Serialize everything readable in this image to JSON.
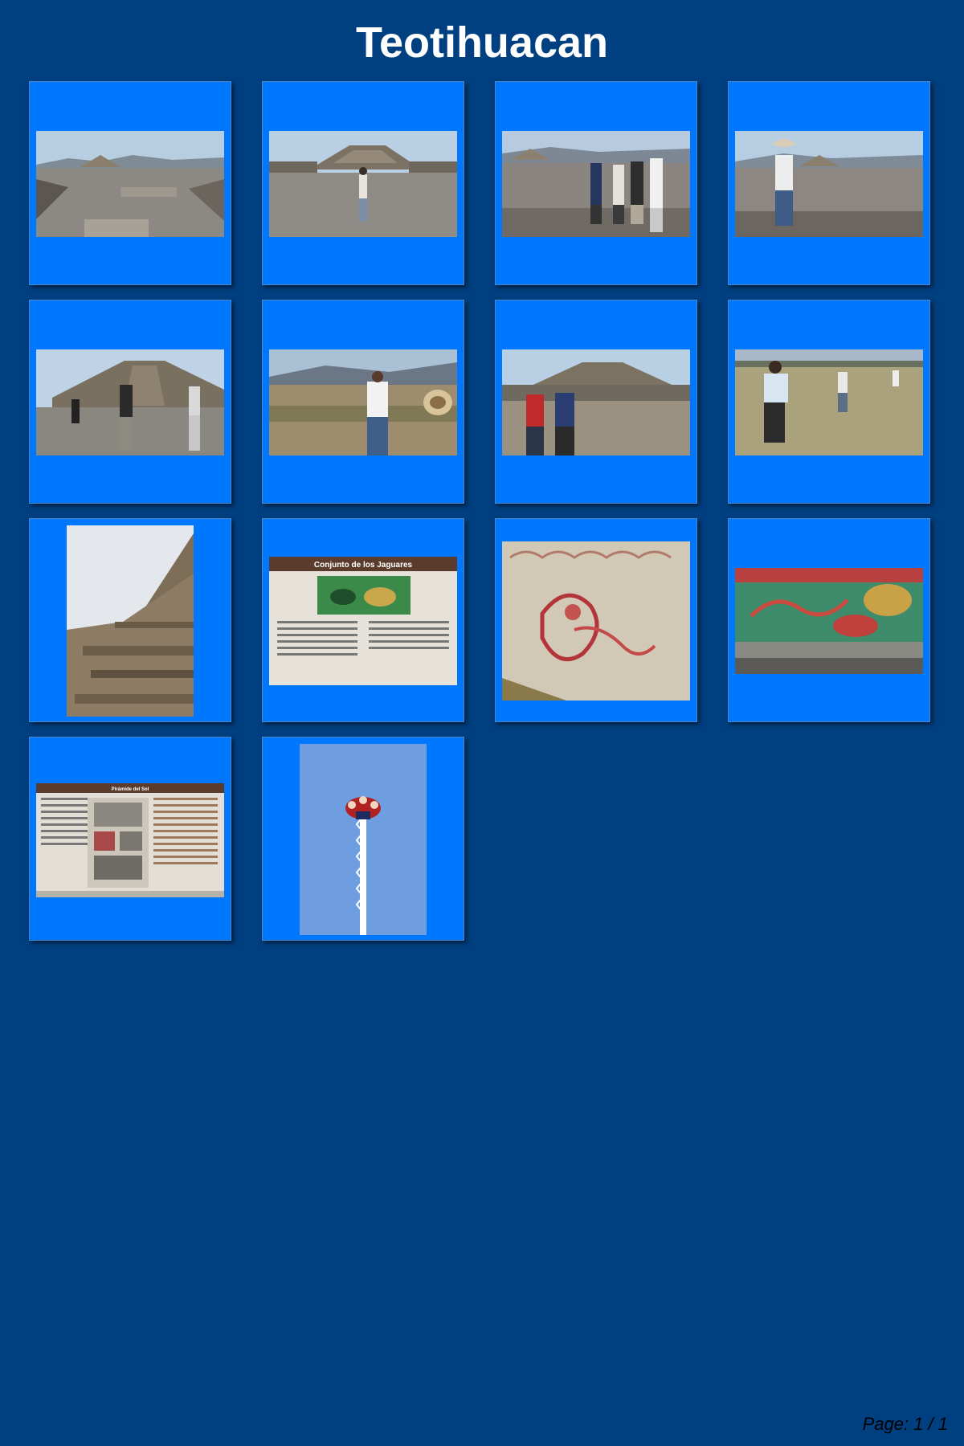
{
  "page": {
    "title": "Teotihuacan",
    "page_indicator": "Page: 1 / 1"
  },
  "colors": {
    "background": "#003f80",
    "card": "#0077ff",
    "title_text": "#ffffff",
    "page_text": "#000000"
  },
  "photos": [
    {
      "scene": "avenue-view-from-pyramid"
    },
    {
      "scene": "person-in-front-of-pyramid"
    },
    {
      "scene": "group-of-four-on-pyramid"
    },
    {
      "scene": "woman-with-hat-overlooking-avenue"
    },
    {
      "scene": "three-people-before-pyramid-of-the-sun"
    },
    {
      "scene": "woman-on-summit-overlooking-valley"
    },
    {
      "scene": "two-men-walking-before-pyramid"
    },
    {
      "scene": "people-walking-in-field"
    },
    {
      "scene": "carved-temple-wall"
    },
    {
      "scene": "jaguar-complex-information-sign",
      "sign_title": "Conjunto de los Jaguares"
    },
    {
      "scene": "red-mural-fresco"
    },
    {
      "scene": "green-jaguar-fresco"
    },
    {
      "scene": "pyramid-information-panel",
      "sign_title": "Pirámide del Sol"
    },
    {
      "scene": "voladores-pole-ceremony"
    }
  ]
}
